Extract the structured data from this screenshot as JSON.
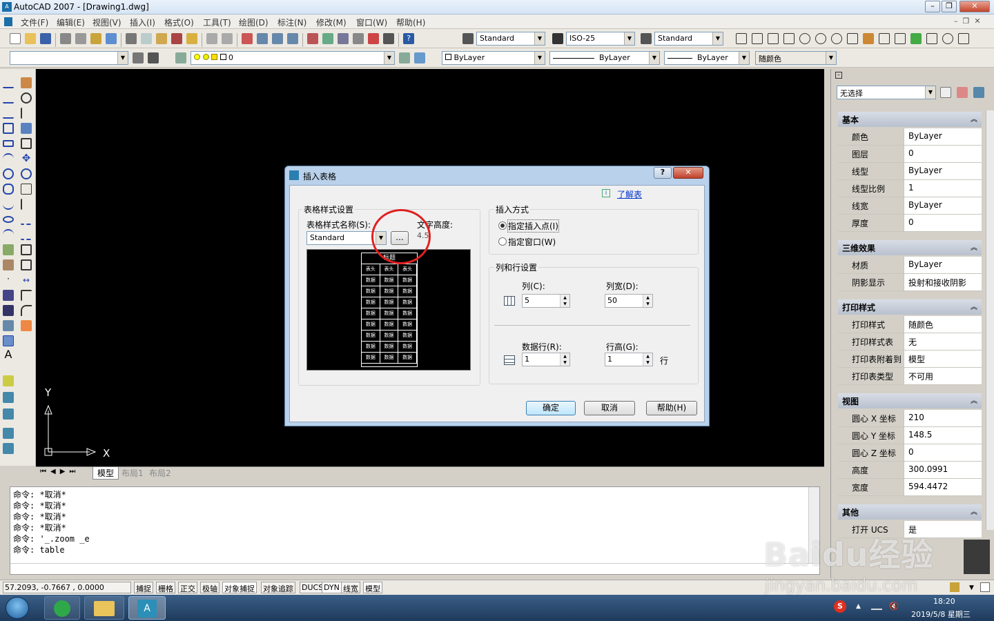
{
  "title": "AutoCAD 2007 - [Drawing1.dwg]",
  "menu": [
    "文件(F)",
    "编辑(E)",
    "视图(V)",
    "插入(I)",
    "格式(O)",
    "工具(T)",
    "绘图(D)",
    "标注(N)",
    "修改(M)",
    "窗口(W)",
    "帮助(H)"
  ],
  "toolbar": {
    "text_style": "Standard",
    "dim_style": "ISO-25",
    "table_style": "Standard",
    "layer": "0",
    "color": "ByLayer",
    "linetype": "ByLayer",
    "lineweight": "ByLayer",
    "plotstyle": "随颜色"
  },
  "tabs": [
    "模型",
    "布局1",
    "布局2"
  ],
  "axis": {
    "x": "X",
    "y": "Y"
  },
  "dialog": {
    "title": "插入表格",
    "learn": "了解表",
    "style_group": "表格样式设置",
    "style_label": "表格样式名称(S):",
    "style_value": "Standard",
    "text_height_label": "文字高度:",
    "text_height": "4.5",
    "browse": "...",
    "preview_header": "标题",
    "preview_cell": "表头",
    "preview_data": "数据",
    "insert_group": "插入方式",
    "opt1": "指定插入点(I)",
    "opt2": "指定窗口(W)",
    "colrow_group": "列和行设置",
    "cols_label": "列(C):",
    "cols": "5",
    "colw_label": "列宽(D):",
    "colw": "50",
    "rows_label": "数据行(R):",
    "rows": "1",
    "rowh_label": "行高(G):",
    "rowh": "1",
    "row_unit": "行",
    "ok": "确定",
    "cancel": "取消",
    "help": "帮助(H)"
  },
  "commands": [
    "命令: *取消*",
    "命令: *取消*",
    "命令: *取消*",
    "命令: *取消*",
    "命令: '_.zoom _e",
    "命令: table"
  ],
  "status": {
    "coords": "57.2093,  -0.7667 , 0.0000",
    "buttons": [
      "捕捉",
      "栅格",
      "正交",
      "极轴",
      "对象捕捉",
      "对象追踪",
      "DUCS",
      "DYN",
      "线宽",
      "模型"
    ]
  },
  "props": {
    "selection": "无选择",
    "sections": [
      {
        "title": "基本",
        "rows": [
          [
            "颜色",
            "ByLayer"
          ],
          [
            "图层",
            "0"
          ],
          [
            "线型",
            "ByLayer"
          ],
          [
            "线型比例",
            "1"
          ],
          [
            "线宽",
            "ByLayer"
          ],
          [
            "厚度",
            "0"
          ]
        ]
      },
      {
        "title": "三维效果",
        "rows": [
          [
            "材质",
            "ByLayer"
          ],
          [
            "阴影显示",
            "投射和接收阴影"
          ]
        ]
      },
      {
        "title": "打印样式",
        "rows": [
          [
            "打印样式",
            "随颜色"
          ],
          [
            "打印样式表",
            "无"
          ],
          [
            "打印表附着到",
            "模型"
          ],
          [
            "打印表类型",
            "不可用"
          ]
        ]
      },
      {
        "title": "视图",
        "rows": [
          [
            "圆心 X 坐标",
            "210"
          ],
          [
            "圆心 Y 坐标",
            "148.5"
          ],
          [
            "圆心 Z 坐标",
            "0"
          ],
          [
            "高度",
            "300.0991"
          ],
          [
            "宽度",
            "594.4472"
          ]
        ]
      },
      {
        "title": "其他",
        "rows": [
          [
            "打开 UCS",
            "是"
          ]
        ]
      }
    ]
  },
  "clock": {
    "time": "18:20",
    "date": "2019/5/8 星期三"
  },
  "watermark": "Baidu经验",
  "watermark_url": "jingyan.baidu.com"
}
